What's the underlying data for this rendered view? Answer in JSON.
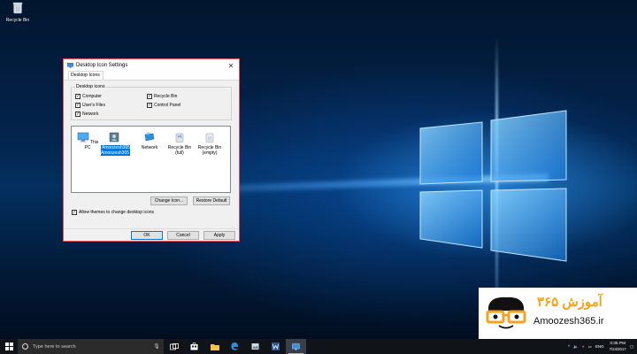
{
  "desktop": {
    "recycle_bin_label": "Recycle Bin"
  },
  "dialog": {
    "title": "Desktop Icon Settings",
    "close_glyph": "✕",
    "tab_label": "Desktop Icons",
    "group_label": "Desktop icons",
    "checkboxes": [
      {
        "label": "Computer",
        "checked": true
      },
      {
        "label": "Recycle Bin",
        "checked": true
      },
      {
        "label": "User's Files",
        "checked": true
      },
      {
        "label": "Control Panel",
        "checked": true
      },
      {
        "label": "Network",
        "checked": true
      }
    ],
    "icons": [
      {
        "label": "This PC"
      },
      {
        "label": "Amoozesh365 Amoozesh365"
      },
      {
        "label": "Network"
      },
      {
        "label": "Recycle Bin (full)"
      },
      {
        "label": "Recycle Bin (empty)"
      }
    ],
    "change_icon_label": "Change Icon...",
    "restore_default_label": "Restore Default",
    "allow_themes_label": "Allow themes to change desktop icons",
    "allow_themes_checked": true,
    "ok_label": "OK",
    "cancel_label": "Cancel",
    "apply_label": "Apply",
    "accent_color": "#e8505b",
    "selection_color": "#0078d7"
  },
  "brand": {
    "persian_text": "آموزش ۳۶۵",
    "site": "Amoozesh365.ir"
  },
  "taskbar": {
    "search_placeholder": "Type here to search",
    "language": "ENG",
    "time": "3:35 PM",
    "date": "7/24/2017"
  }
}
